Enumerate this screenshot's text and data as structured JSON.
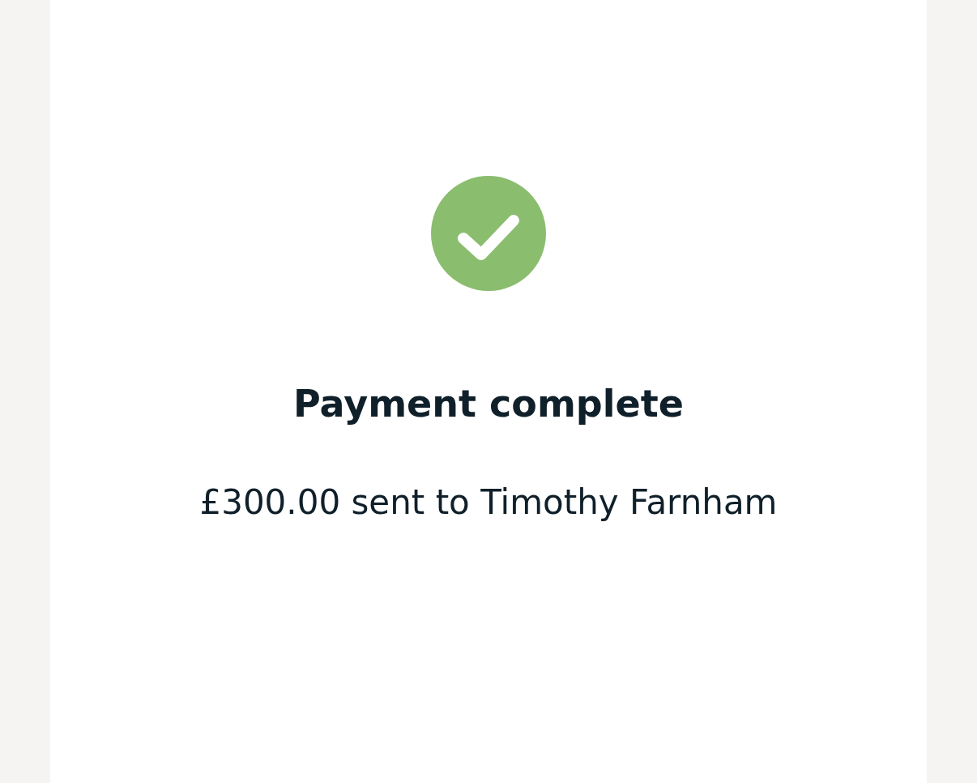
{
  "status": {
    "kind": "success"
  },
  "title": "Payment complete",
  "message": "£300.00 sent to Timothy Farnham"
}
